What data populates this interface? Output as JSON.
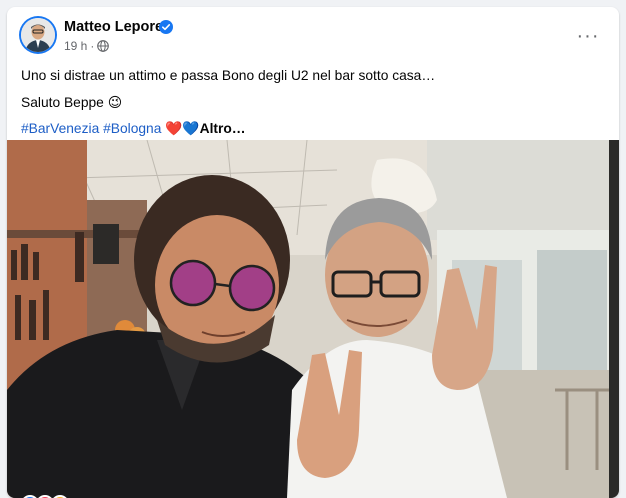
{
  "post": {
    "author": "Matteo Lepore",
    "time": "19 h",
    "separator": "·",
    "text_line1": "Uno si distrae un attimo e passa Bono degli U2 nel bar sotto casa…",
    "text_line2": "Saluto Beppe",
    "emoji_smile": "😉",
    "hashtag1": "#BarVenezia",
    "hashtag2": "#Bologna",
    "hearts": "❤️💙",
    "ellipsis": "…",
    "more_label": "Altro…",
    "more_options": "···"
  },
  "colors": {
    "accent": "#1877f2",
    "hashtag": "#1d5ec6",
    "meta": "#65676b",
    "background": "#f0f2f5"
  },
  "icons": {
    "verified": "verified-badge-icon",
    "audience": "globe-icon",
    "menu": "more-options-icon"
  }
}
